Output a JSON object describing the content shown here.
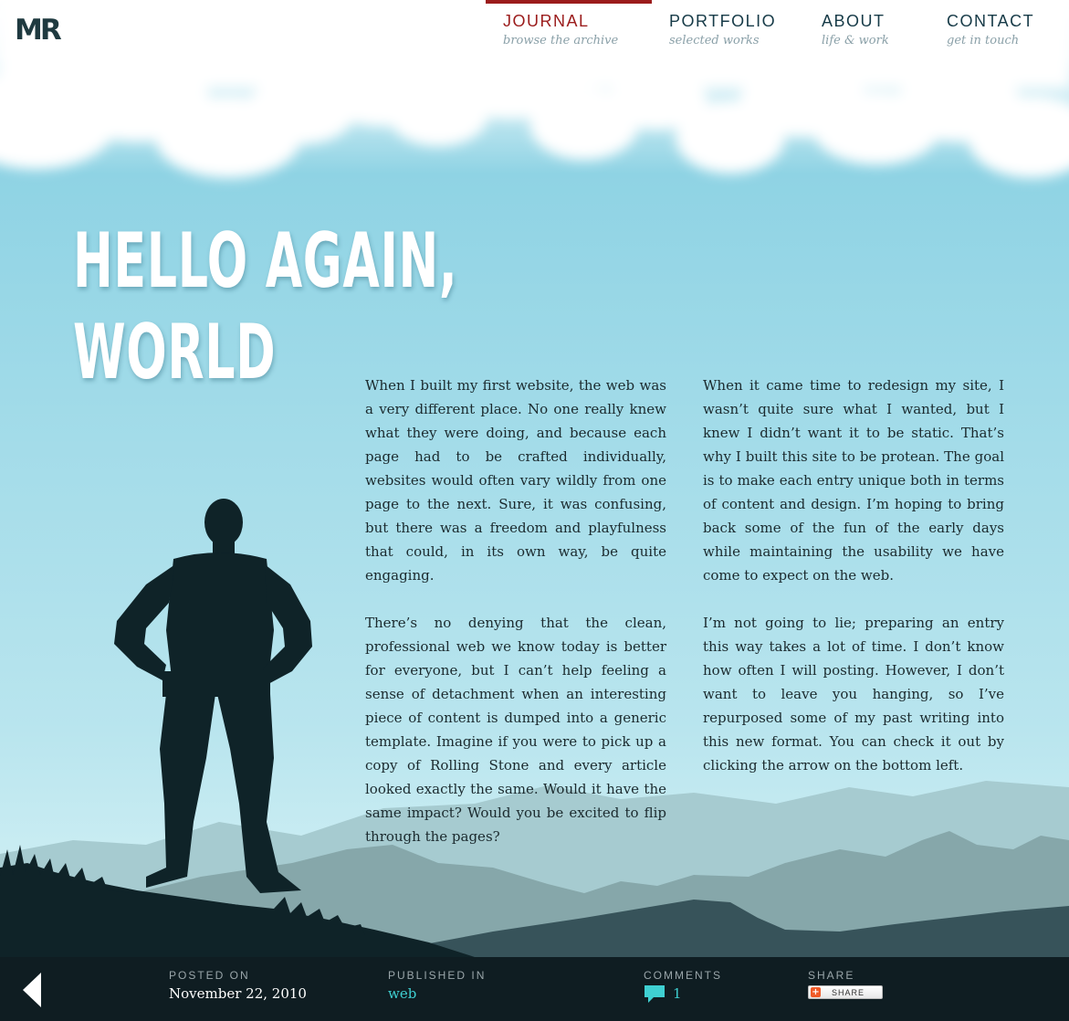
{
  "logo": {
    "text": "MR"
  },
  "nav": [
    {
      "label": "JOURNAL",
      "sub": "browse the archive",
      "active": true
    },
    {
      "label": "PORTFOLIO",
      "sub": "selected works",
      "active": false
    },
    {
      "label": "ABOUT",
      "sub": "life & work",
      "active": false
    },
    {
      "label": "CONTACT",
      "sub": "get in touch",
      "active": false
    }
  ],
  "article": {
    "title_line1": "HELLO AGAIN,",
    "title_line2": "WORLD",
    "col1": [
      "When I built my first website, the web was a very different place. No one really knew what they were doing, and because each page had to be crafted individually, websites would often vary wildly from one page to the next. Sure, it was confusing, but there was a freedom and playfulness that could, in its own way, be quite engaging.",
      "There’s no denying that the clean, professional web we know today is better for everyone, but I can’t help feeling a sense of detachment when an interesting piece of content is dumped into a generic template. Imagine if you were to pick up a copy of Rolling Stone and every article looked exactly the same. Would it have the same impact? Would you be excited to flip through the pages?"
    ],
    "col2": [
      "When it came time to redesign my site, I wasn’t quite sure what I wanted, but I knew I didn’t want it to be static. That’s why I built this site to be protean. The goal is to make each entry unique both in terms of content and design. I’m hoping to bring back some of the fun of the early days while maintaining the usability we have come to expect on the web.",
      "I’m not going to lie; preparing an entry this way takes a lot of time. I don’t know how often I will posting. However, I don’t want to leave you hanging, so I’ve repurposed some of my past writing into this new format. You can check it out by clicking the arrow on the bottom left."
    ]
  },
  "footer": {
    "posted_label": "POSTED ON",
    "posted_value": "November 22, 2010",
    "published_label": "PUBLISHED IN",
    "published_value": "web",
    "comments_label": "COMMENTS",
    "comments_count": "1",
    "share_label": "SHARE",
    "share_button": "SHARE",
    "share_plus": "+"
  },
  "colors": {
    "accent": "#9b1c1c",
    "link": "#3fd0d2",
    "footer_bg": "#0f1d22",
    "silhouette": "#0f2328"
  },
  "icons": [
    "back-arrow-icon",
    "comment-bubble-icon",
    "share-plus-icon"
  ]
}
